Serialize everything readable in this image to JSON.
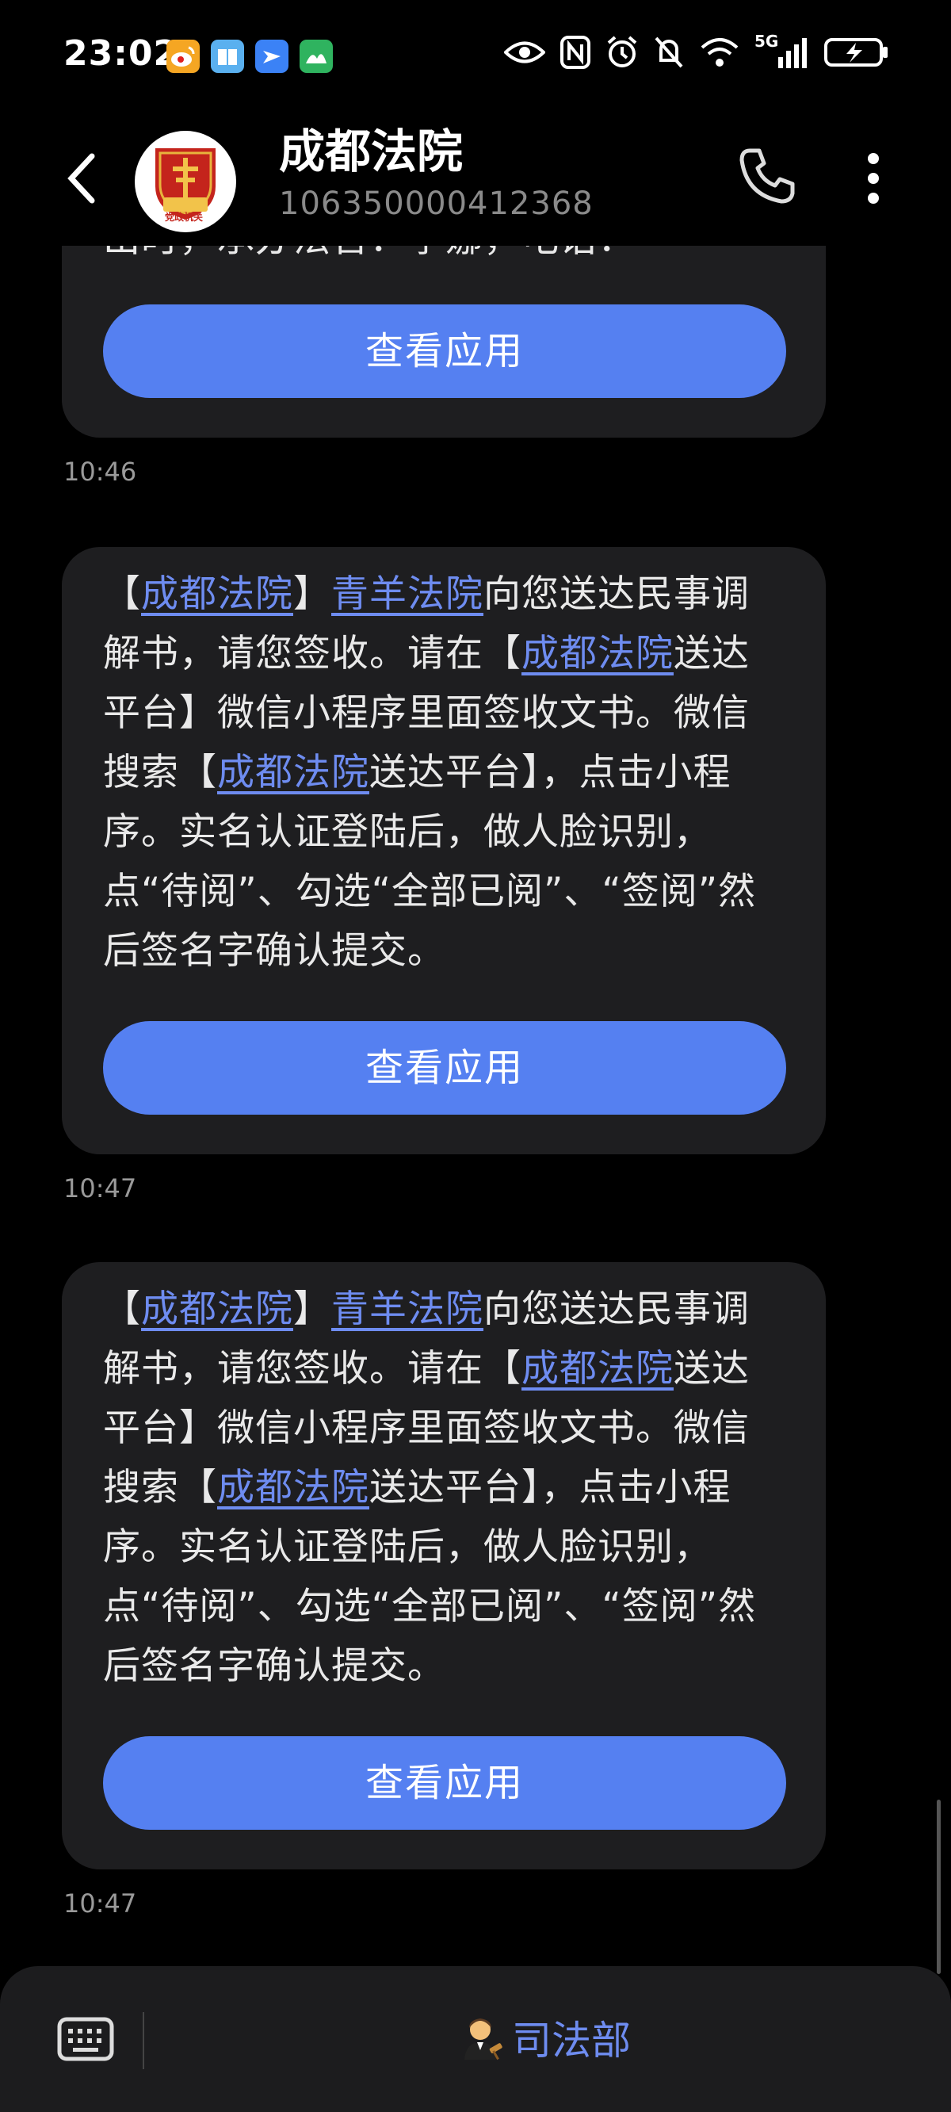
{
  "status": {
    "time": "23:02",
    "network": "5G"
  },
  "header": {
    "name": "成都法院",
    "number": "106350000412368",
    "avatar_text": "党政机关"
  },
  "partial_message": {
    "text_fragment": "出时，承办法官：李娜，电话："
  },
  "messages": [
    {
      "parts": [
        "【",
        "成都法院",
        "】",
        "青羊法院",
        "向您送达民事调解书，请您签收。请在【",
        "成都法院",
        "送达平台】微信小程序里面签收文书。微信搜索【",
        "成都法院",
        "送达平台】，点击小程序。实名认证登陆后，做人脸识别，点“待阅”、勾选“全部已阅”、“签阅”然后签名字确认提交。"
      ],
      "time": "10:47"
    },
    {
      "parts": [
        "【",
        "成都法院",
        "】",
        "青羊法院",
        "向您送达民事调解书，请您签收。请在【",
        "成都法院",
        "送达平台】微信小程序里面签收文书。微信搜索【",
        "成都法院",
        "送达平台】，点击小程序。实名认证登陆后，做人脸识别，点“待阅”、勾选“全部已阅”、“签阅”然后签名字确认提交。"
      ],
      "time": "10:47"
    }
  ],
  "first_time": "10:46",
  "button_label": "查看应用",
  "footer": {
    "signature": "司法部"
  },
  "colors": {
    "accent": "#5580f1",
    "link": "#6e8cf0",
    "bubble": "#1e1e20"
  }
}
